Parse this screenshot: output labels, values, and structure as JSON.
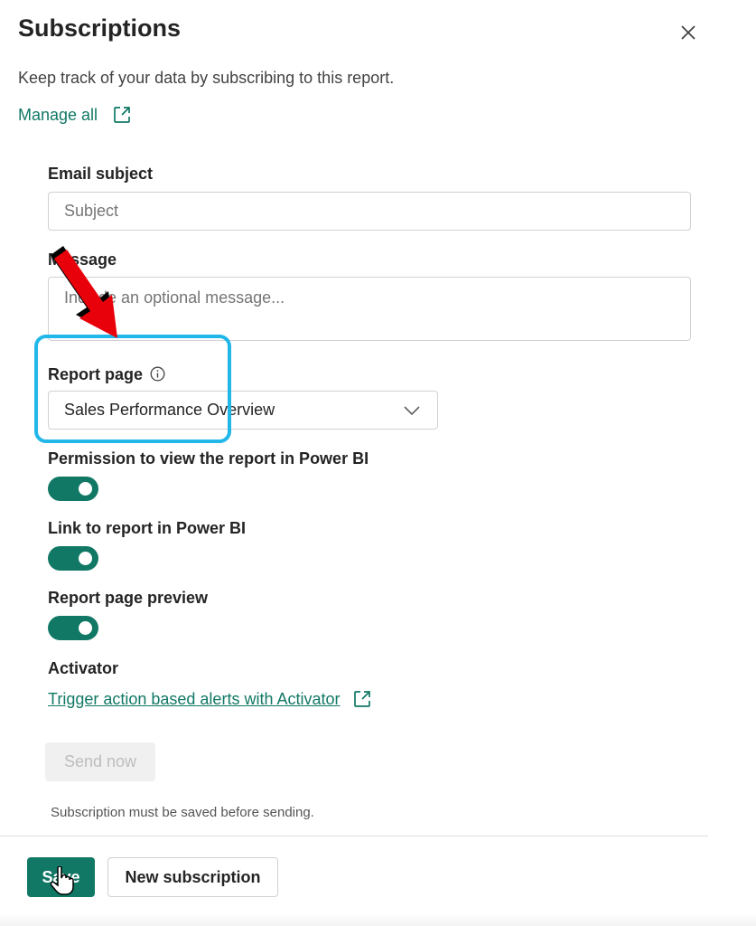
{
  "header": {
    "title": "Subscriptions",
    "close_icon": "close-icon"
  },
  "intro_text": "Keep track of your data by subscribing to this report.",
  "manage_all": {
    "label": "Manage all",
    "icon": "external-link-icon"
  },
  "email_subject": {
    "label": "Email subject",
    "placeholder": "Subject",
    "value": ""
  },
  "message": {
    "label": "Message",
    "placeholder": "Include an optional message...",
    "value": ""
  },
  "report_page": {
    "label": "Report page",
    "info_icon": "info-icon",
    "selected": "Sales Performance Overview",
    "chevron_icon": "chevron-down-icon"
  },
  "toggles": [
    {
      "label": "Permission to view the report in Power BI",
      "on": true
    },
    {
      "label": "Link to report in Power BI",
      "on": true
    },
    {
      "label": "Report page preview",
      "on": true
    }
  ],
  "activator": {
    "label": "Activator",
    "link_text": "Trigger action based alerts with Activator",
    "icon": "external-link-icon"
  },
  "send_now": {
    "label": "Send now",
    "disabled": true
  },
  "save_note": "Subscription must be saved before sending.",
  "footer": {
    "save_label": "Save",
    "new_subscription_label": "New subscription"
  },
  "colors": {
    "accent": "#117865",
    "highlight": "#22b7e9",
    "arrow": "#e8000b"
  }
}
